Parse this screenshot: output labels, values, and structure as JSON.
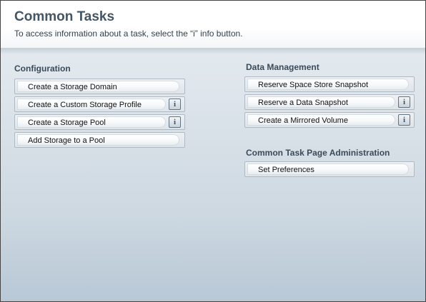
{
  "header": {
    "title": "Common Tasks",
    "subtitle": "To access information about a task, select the “i” info button."
  },
  "configuration": {
    "title": "Configuration",
    "tasks": [
      {
        "label": "Create a Storage Domain",
        "info": false
      },
      {
        "label": "Create a Custom Storage Profile",
        "info": true,
        "info_label": "i"
      },
      {
        "label": "Create a Storage Pool",
        "info": true,
        "info_label": "i"
      },
      {
        "label": "Add Storage to a Pool",
        "info": false
      }
    ]
  },
  "data_management": {
    "title": "Data Management",
    "tasks": [
      {
        "label": "Reserve Space Store Snapshot",
        "info": false
      },
      {
        "label": "Reserve a Data Snapshot",
        "info": true,
        "info_label": "i"
      },
      {
        "label": "Create a Mirrored Volume",
        "info": true,
        "info_label": "i"
      }
    ]
  },
  "administration": {
    "title": "Common Task Page Administration",
    "tasks": [
      {
        "label": "Set Preferences",
        "info": false
      }
    ]
  }
}
